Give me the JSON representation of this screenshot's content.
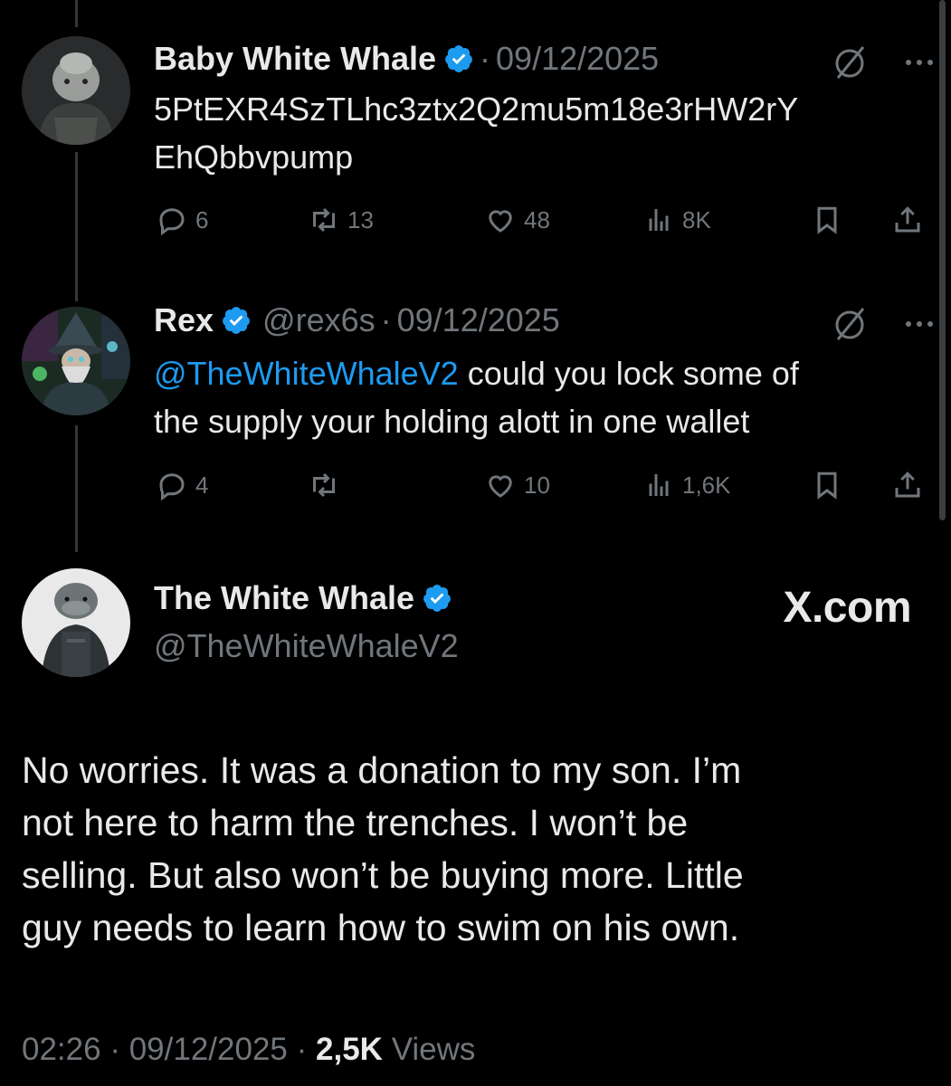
{
  "thread": [
    {
      "display_name": "Baby White Whale",
      "date_prefix": "·",
      "date": "09/12/2025",
      "text_lines": [
        "5PtEXR4SzTLhc3ztx2Q2mu5m18e3rHW2rY",
        "EhQbbvpump"
      ],
      "actions": {
        "replies": "6",
        "reposts": "13",
        "likes": "48",
        "views": "8K"
      }
    },
    {
      "display_name": "Rex",
      "handle": "@rex6s",
      "date_prefix": "·",
      "date": "09/12/2025",
      "mention": "@TheWhiteWhaleV2",
      "text_after_mention": " could you lock some of",
      "text_line2": "the supply your holding alott in one wallet",
      "actions": {
        "replies": "4",
        "reposts": "",
        "likes": "10",
        "views": "1,6K"
      }
    }
  ],
  "main_tweet": {
    "display_name": "The White Whale",
    "handle": "@TheWhiteWhaleV2",
    "brand_label": "X.com",
    "text_lines": [
      "No worries. It was a donation to my son. I’m",
      "not here to harm the trenches. I won’t be",
      "selling. But also won’t be buying more. Little",
      "guy needs to learn how to swim on his own."
    ],
    "time": "02:26",
    "sep": "·",
    "date": "09/12/2025",
    "views_count": "2,5K",
    "views_label": "Views"
  },
  "icons": {
    "verified": "verified-badge-icon",
    "grok": "slash-circle-icon",
    "more": "more-dots-icon",
    "reply": "reply-bubble-icon",
    "repost": "repost-icon",
    "like": "heart-icon",
    "views": "analytics-bars-icon",
    "bookmark": "bookmark-icon",
    "share": "share-icon"
  },
  "colors": {
    "background": "#000000",
    "text": "#e7e9ea",
    "muted": "#71767b",
    "accent": "#1d9bf0"
  }
}
